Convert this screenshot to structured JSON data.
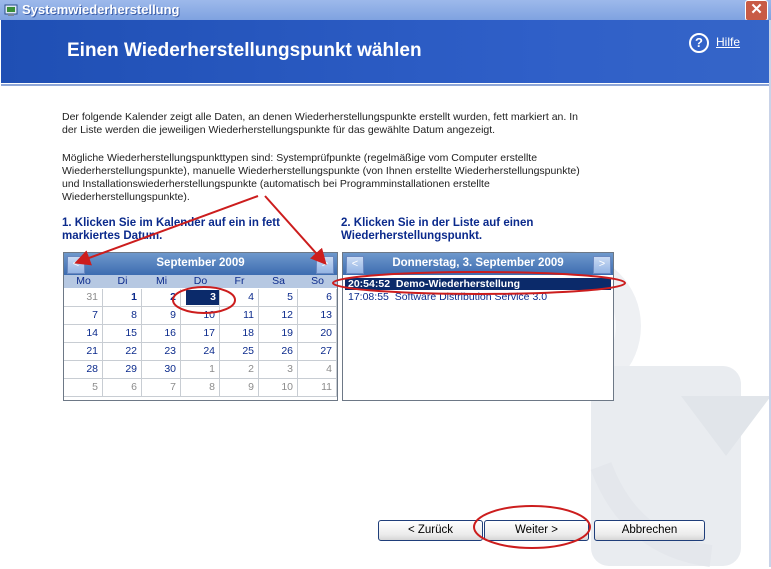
{
  "window": {
    "title": "Systemwiederherstellung",
    "close_label": "✕"
  },
  "banner": {
    "title": "Einen Wiederherstellungspunkt wählen",
    "help_label": "Hilfe"
  },
  "intro": {
    "para1_line1": "Der folgende Kalender zeigt alle Daten, an denen Wiederherstellungspunkte erstellt wurden, fett markiert an. In",
    "para1_line2": "der Liste werden die jeweiligen Wiederherstellungspunkte für das gewählte Datum angezeigt.",
    "para2_line1": "Mögliche Wiederherstellungspunkttypen sind: Systemprüfpunkte (regelmäßige vom Computer erstellte",
    "para2_line2": "Wiederherstellungspunkte), manuelle Wiederherstellungspunkte (von Ihnen erstellte Wiederherstellungspunkte)",
    "para2_line3": "und Installationswiederherstellungspunkte (automatisch bei Programminstallationen erstellte",
    "para2_line4": "Wiederherstellungspunkte)."
  },
  "step1": {
    "line1": "1. Klicken Sie im Kalender auf ein in fett",
    "line2": "markiertes Datum."
  },
  "step2": {
    "line1": "2. Klicken Sie in der Liste auf einen",
    "line2": "Wiederherstellungspunkt."
  },
  "calendar": {
    "month_title": "September 2009",
    "prev": "<",
    "next": ">",
    "weekdays": [
      "Mo",
      "Di",
      "Mi",
      "Do",
      "Fr",
      "Sa",
      "So"
    ],
    "weeks": [
      [
        "31",
        "1",
        "2",
        "3",
        "4",
        "5",
        "6"
      ],
      [
        "7",
        "8",
        "9",
        "10",
        "11",
        "12",
        "13"
      ],
      [
        "14",
        "15",
        "16",
        "17",
        "18",
        "19",
        "20"
      ],
      [
        "21",
        "22",
        "23",
        "24",
        "25",
        "26",
        "27"
      ],
      [
        "28",
        "29",
        "30",
        "1",
        "2",
        "3",
        "4"
      ],
      [
        "5",
        "6",
        "7",
        "8",
        "9",
        "10",
        "11"
      ]
    ],
    "selected": "3"
  },
  "restore_list": {
    "date_title": "Donnerstag, 3. September 2009",
    "prev": "<",
    "next": ">",
    "items": [
      {
        "time": "20:54:52",
        "name": "Demo-Wiederherstellung"
      },
      {
        "time": "17:08:55",
        "name": "Software Distribution Service 3.0"
      }
    ]
  },
  "buttons": {
    "back": "< Zurück",
    "next": "Weiter >",
    "cancel": "Abbrechen"
  },
  "colors": {
    "banner": "#2f5fc8",
    "accent_text": "#0b2a8c",
    "selection": "#0b2a6a",
    "annotation_red": "#cc1d1d"
  }
}
